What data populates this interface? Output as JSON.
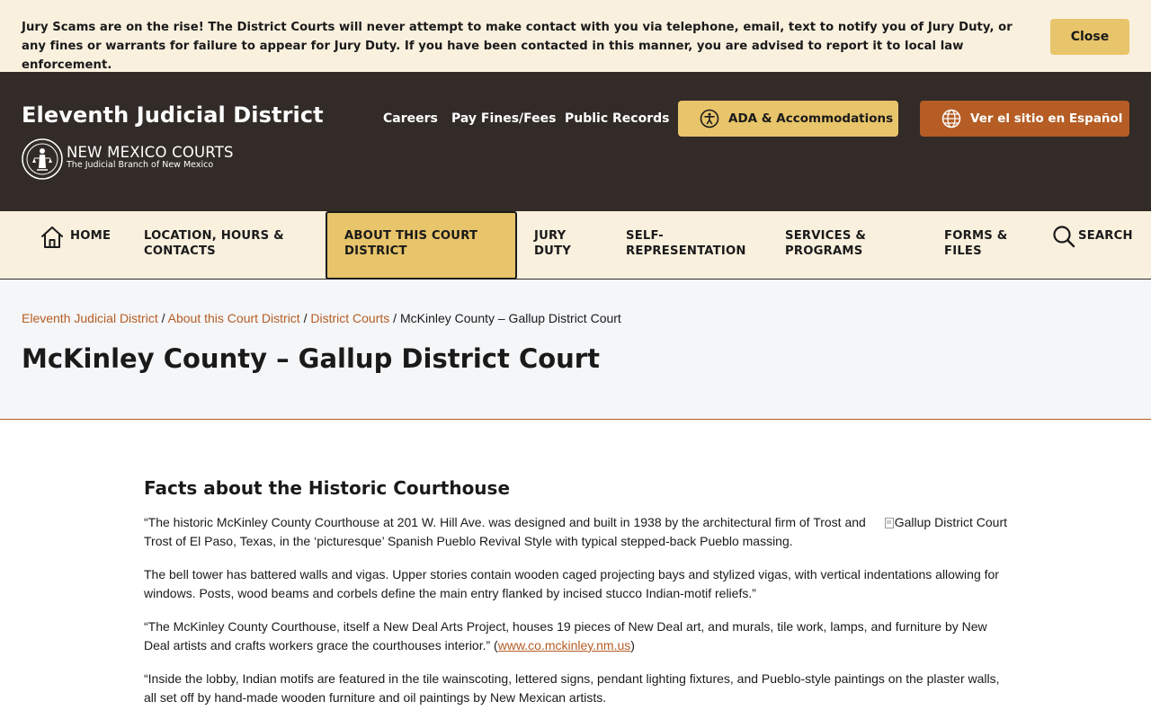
{
  "alert": {
    "message": "Jury Scams are on the rise! The District Courts will never attempt to make contact with you via telephone, email, text to notify you of Jury Duty, or any fines or warrants for failure to appear for Jury Duty. If you have been contacted in this manner, you are advised to report it to local law enforcement.",
    "close_label": "Close"
  },
  "header": {
    "site_title": "Eleventh Judicial District",
    "logo_name": "NEW MEXICO COURTS",
    "logo_tagline": "The Judicial Branch of New Mexico",
    "util_links": [
      "Careers",
      "Pay Fines/Fees",
      "Public Records"
    ],
    "ada_label": "ADA & Accommodations",
    "spanish_label": "Ver el sitio en Español"
  },
  "nav": {
    "home": "Home",
    "items": [
      "Location, Hours & Contacts",
      "About this Court District",
      "Jury Duty",
      "Self-Representation",
      "Services & Programs",
      "Forms & Files"
    ],
    "search": "Search",
    "active_index": 1
  },
  "breadcrumb": {
    "links": [
      "Eleventh Judicial District",
      "About this Court District",
      "District Courts"
    ],
    "separator": " / ",
    "current": "McKinley County – Gallup District Court"
  },
  "page_title": "McKinley County – Gallup District Court",
  "content": {
    "section_title": "Facts about the Historic Courthouse",
    "image_alt": "Gallup District Court",
    "p1": "“The historic McKinley County Courthouse at 201 W. Hill Ave. was designed and built in 1938 by the architectural firm of Trost and Trost of El Paso, Texas, in the ‘picturesque’ Spanish Pueblo Revival Style with typical stepped-back Pueblo massing.",
    "p2": "The bell tower has battered walls and vigas. Upper stories contain wooden caged projecting bays and stylized vigas, with vertical indentations allowing for windows. Posts, wood beams and corbels define the main entry flanked by incised stucco Indian-motif reliefs.”",
    "p3_text": "“The McKinley County Courthouse, itself a New Deal Arts Project, houses 19 pieces of New Deal art, and murals, tile work, lamps, and furniture by New Deal artists and crafts workers grace the courthouses interior.” (",
    "p3_link": "www.co.mckinley.nm.us",
    "p3_end": ")",
    "p4": "“Inside the lobby, Indian motifs are featured in the tile wainscoting, lettered signs, pendant lighting fixtures, and Pueblo-style paintings on the plaster walls, all set off by hand-made wooden furniture and oil paintings by New Mexican artists."
  },
  "colors": {
    "banner_bg": "#faf0de",
    "header_bg": "#322b27",
    "accent_gold": "#e8c46a",
    "accent_rust": "#b55d25",
    "page_head_bg": "#f5f6f8"
  }
}
